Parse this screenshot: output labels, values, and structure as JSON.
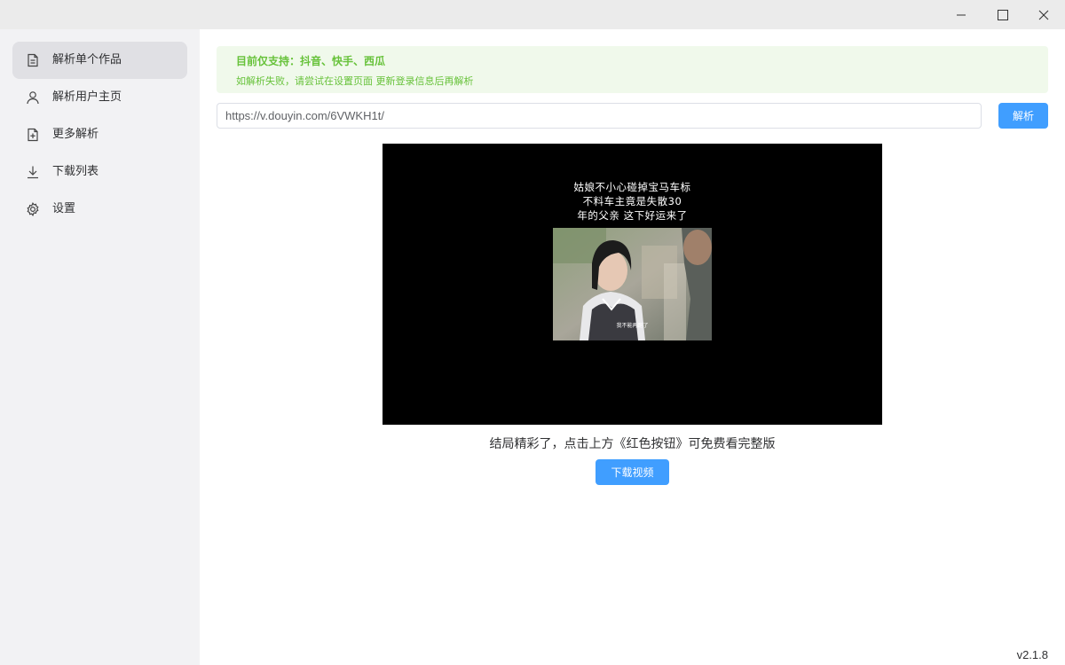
{
  "window": {
    "controls": [
      "minimize-icon",
      "maximize-icon",
      "close-icon"
    ]
  },
  "sidebar": {
    "items": [
      {
        "label": "解析单个作品",
        "icon": "document-icon",
        "active": true
      },
      {
        "label": "解析用户主页",
        "icon": "user-icon",
        "active": false
      },
      {
        "label": "更多解析",
        "icon": "document-add-icon",
        "active": false
      },
      {
        "label": "下载列表",
        "icon": "download-icon",
        "active": false
      },
      {
        "label": "设置",
        "icon": "gear-icon",
        "active": false
      }
    ]
  },
  "notice": {
    "title": "目前仅支持：抖音、快手、西瓜",
    "description": "如解析失败，请尝试在设置页面 更新登录信息后再解析"
  },
  "search": {
    "value": "https://v.douyin.com/6VWKH1t/",
    "button_label": "解析"
  },
  "video": {
    "caption_lines": [
      "姑娘不小心碰掉宝马车标",
      "不料车主竟是失散30",
      "年的父亲  这下好运来了"
    ],
    "frame_subtitle": "我不能再跑了"
  },
  "result": {
    "description": "结局精彩了，点击上方《红色按钮》可免费看完整版",
    "download_label": "下载视频"
  },
  "version": "v2.1.8",
  "colors": {
    "accent": "#409eff",
    "success": "#67c23a",
    "notice_bg": "#f0f9eb",
    "sidebar_bg": "#f2f2f4",
    "active_item_bg": "#e0e0e4"
  }
}
